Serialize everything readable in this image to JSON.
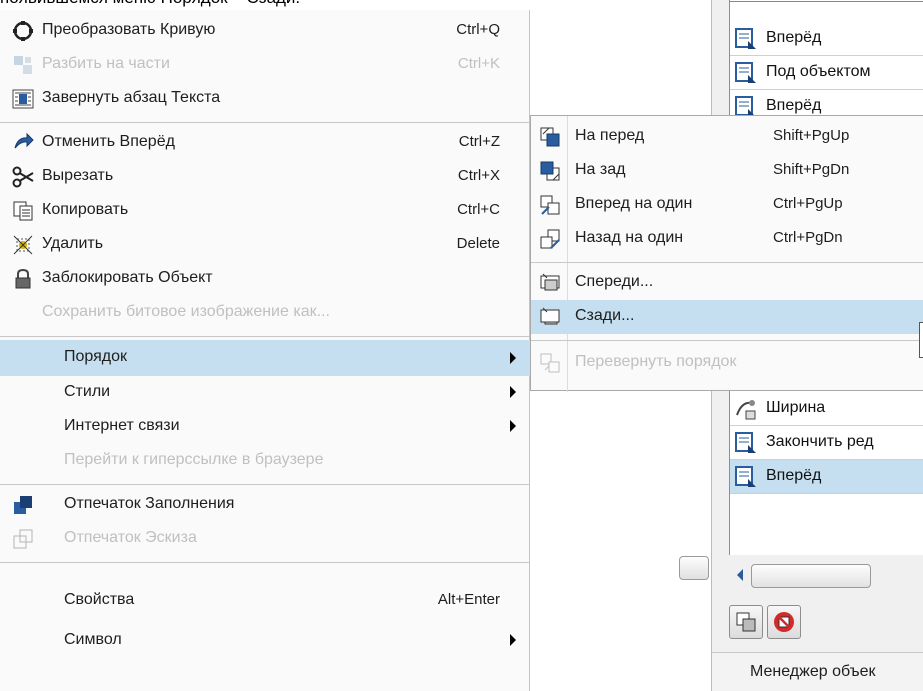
{
  "caption": "появившемся меню Порядок – Сзади.",
  "context_menu": {
    "items": [
      {
        "label": "Преобразовать Кривую",
        "shortcut": "Ctrl+Q",
        "icon": "convert-curve-icon",
        "state": "normal"
      },
      {
        "label": "Разбить на части",
        "shortcut": "Ctrl+K",
        "icon": "break-apart-icon",
        "state": "disabled"
      },
      {
        "label": "Завернуть абзац Текста",
        "shortcut": "",
        "icon": "wrap-paragraph-icon",
        "state": "normal"
      },
      {
        "label": "Отменить Вперёд",
        "shortcut": "Ctrl+Z",
        "icon": "undo-icon",
        "state": "normal"
      },
      {
        "label": "Вырезать",
        "shortcut": "Ctrl+X",
        "icon": "scissors-icon",
        "state": "normal"
      },
      {
        "label": "Копировать",
        "shortcut": "Ctrl+C",
        "icon": "copy-icon",
        "state": "normal"
      },
      {
        "label": "Удалить",
        "shortcut": "Delete",
        "icon": "delete-icon",
        "state": "normal"
      },
      {
        "label": "Заблокировать Объект",
        "shortcut": "",
        "icon": "lock-icon",
        "state": "normal"
      },
      {
        "label": "Сохранить битовое изображение как...",
        "shortcut": "",
        "icon": "",
        "state": "disabled"
      },
      {
        "label": "Порядок",
        "shortcut": "",
        "icon": "",
        "state": "highlighted",
        "submenu": true
      },
      {
        "label": "Стили",
        "shortcut": "",
        "icon": "",
        "state": "normal",
        "submenu": true
      },
      {
        "label": "Интернет связи",
        "shortcut": "",
        "icon": "",
        "state": "normal",
        "submenu": true
      },
      {
        "label": "Перейти к гиперссылке в браузере",
        "shortcut": "",
        "icon": "",
        "state": "disabled"
      },
      {
        "label": "Отпечаток Заполнения",
        "shortcut": "",
        "icon": "fill-stamp-icon",
        "state": "normal"
      },
      {
        "label": "Отпечаток Эскиза",
        "shortcut": "",
        "icon": "outline-stamp-icon",
        "state": "disabled"
      },
      {
        "label": "Свойства",
        "shortcut": "Alt+Enter",
        "icon": "",
        "state": "normal"
      },
      {
        "label": "Символ",
        "shortcut": "",
        "icon": "",
        "state": "normal",
        "submenu": true
      }
    ]
  },
  "order_submenu": {
    "items": [
      {
        "label": "На перед",
        "shortcut": "Shift+PgUp",
        "icon": "to-front-icon",
        "state": "normal"
      },
      {
        "label": "На зад",
        "shortcut": "Shift+PgDn",
        "icon": "to-back-icon",
        "state": "normal"
      },
      {
        "label": "Вперед на один",
        "shortcut": "Ctrl+PgUp",
        "icon": "forward-one-icon",
        "state": "normal"
      },
      {
        "label": "Назад на один",
        "shortcut": "Ctrl+PgDn",
        "icon": "back-one-icon",
        "state": "normal"
      },
      {
        "label": "Спереди...",
        "shortcut": "",
        "icon": "in-front-of-icon",
        "state": "normal"
      },
      {
        "label": "Сзади...",
        "shortcut": "",
        "icon": "behind-icon",
        "state": "highlighted"
      },
      {
        "label": "Перевернуть порядок",
        "shortcut": "",
        "icon": "reverse-order-icon",
        "state": "disabled"
      }
    ]
  },
  "object_manager": {
    "rows": [
      {
        "label": "Вперёд",
        "icon": "object-icon",
        "state": "normal"
      },
      {
        "label": "Под объектом",
        "icon": "object-icon",
        "state": "normal"
      },
      {
        "label": "Вперёд",
        "icon": "object-icon",
        "state": "normal"
      },
      {
        "label": "Ширина",
        "icon": "width-icon",
        "state": "normal"
      },
      {
        "label": "Закончить ред",
        "icon": "object-icon",
        "state": "normal"
      },
      {
        "label": "Вперёд",
        "icon": "object-icon",
        "state": "highlighted"
      }
    ],
    "footer_label": "Менеджер объек"
  },
  "colors": {
    "highlight": "#c5dff0",
    "menu_bg": "#fafafa",
    "disabled_text": "#c0c0c0",
    "icon_blue": "#2a5d9f"
  }
}
